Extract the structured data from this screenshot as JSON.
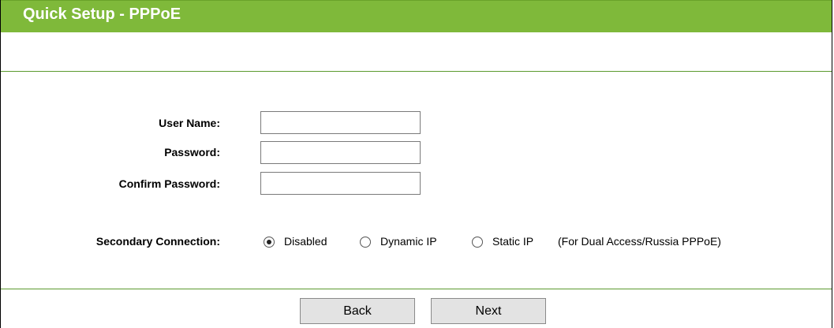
{
  "header": {
    "title": "Quick Setup - PPPoE"
  },
  "form": {
    "username": {
      "label": "User Name:",
      "value": ""
    },
    "password": {
      "label": "Password:",
      "value": ""
    },
    "confirm_password": {
      "label": "Confirm Password:",
      "value": ""
    },
    "secondary_connection": {
      "label": "Secondary Connection:",
      "options": [
        {
          "label": "Disabled",
          "checked": true
        },
        {
          "label": "Dynamic IP",
          "checked": false
        },
        {
          "label": "Static IP",
          "checked": false
        }
      ],
      "note": "(For Dual Access/Russia PPPoE)"
    }
  },
  "buttons": {
    "back": "Back",
    "next": "Next"
  },
  "colors": {
    "header_bg": "#7fb93a",
    "divider": "#5b9a2e"
  }
}
